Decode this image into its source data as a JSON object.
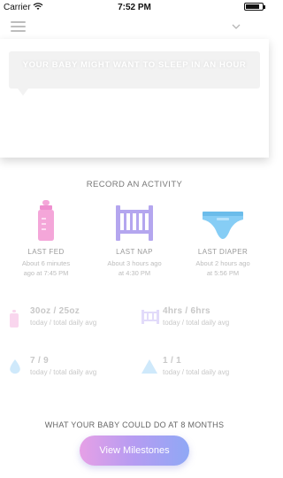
{
  "status_bar": {
    "carrier": "Carrier",
    "time": "7:52 PM",
    "battery_level": 0.85
  },
  "hero": {
    "message": "YOUR BABY MIGHT WANT TO SLEEP IN AN HOUR"
  },
  "record": {
    "title": "RECORD AN ACTIVITY",
    "items": [
      {
        "label": "LAST FED",
        "line1": "About 6 minutes",
        "line2": "ago at 7:45 PM",
        "icon": "bottle-icon",
        "color": "#f4a6d9"
      },
      {
        "label": "LAST NAP",
        "line1": "About 3 hours ago",
        "line2": "at 4:30 PM",
        "icon": "crib-icon",
        "color": "#b4a6ef"
      },
      {
        "label": "LAST DIAPER",
        "line1": "About 2 hours ago",
        "line2": "at 5:56 PM",
        "icon": "diaper-icon",
        "color": "#86cdf5"
      }
    ]
  },
  "stats": [
    {
      "value": "30oz / 25oz",
      "caption": "today / total daily avg",
      "icon": "bottle-icon",
      "color": "#f9d6ee"
    },
    {
      "value": "4hrs / 6hrs",
      "caption": "today / total daily avg",
      "icon": "crib-icon",
      "color": "#e2dbfa"
    },
    {
      "value": "7 / 9",
      "caption": "today / total daily avg",
      "icon": "drop-icon",
      "color": "#cfe9fb"
    },
    {
      "value": "1 / 1",
      "caption": "today / total daily avg",
      "icon": "pee-icon",
      "color": "#cfe9fb"
    }
  ],
  "milestones": {
    "title": "WHAT YOUR BABY COULD DO AT 8 MONTHS",
    "button": "View Milestones"
  }
}
